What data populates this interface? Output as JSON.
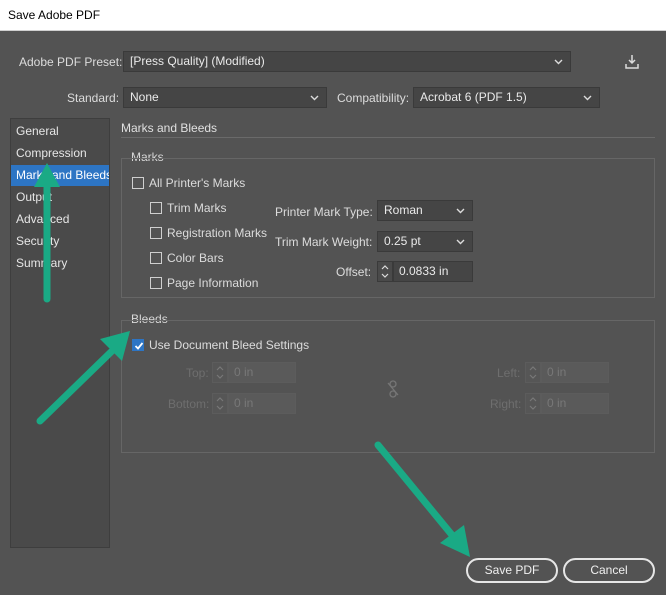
{
  "window": {
    "title": "Save Adobe PDF"
  },
  "preset": {
    "label": "Adobe PDF Preset:",
    "value": "[Press Quality] (Modified)"
  },
  "standard": {
    "label": "Standard:",
    "value": "None"
  },
  "compatibility": {
    "label": "Compatibility:",
    "value": "Acrobat 6 (PDF 1.5)"
  },
  "sidebar": {
    "items": [
      {
        "label": "General"
      },
      {
        "label": "Compression"
      },
      {
        "label": "Marks and Bleeds"
      },
      {
        "label": "Output"
      },
      {
        "label": "Advanced"
      },
      {
        "label": "Security"
      },
      {
        "label": "Summary"
      }
    ],
    "selected": "Marks and Bleeds"
  },
  "panel": {
    "title": "Marks and Bleeds",
    "marks": {
      "title": "Marks",
      "all_printers_marks": {
        "label": "All Printer's Marks",
        "checked": false
      },
      "trim_marks": {
        "label": "Trim Marks",
        "checked": false
      },
      "registration_marks": {
        "label": "Registration Marks",
        "checked": false
      },
      "color_bars": {
        "label": "Color Bars",
        "checked": false
      },
      "page_information": {
        "label": "Page Information",
        "checked": false
      },
      "printer_mark_type": {
        "label": "Printer Mark Type:",
        "value": "Roman"
      },
      "trim_mark_weight": {
        "label": "Trim Mark Weight:",
        "value": "0.25 pt"
      },
      "offset": {
        "label": "Offset:",
        "value": "0.0833 in"
      }
    },
    "bleeds": {
      "title": "Bleeds",
      "use_document_bleed": {
        "label": "Use Document Bleed Settings",
        "checked": true
      },
      "top": {
        "label": "Top:",
        "value": "0 in"
      },
      "bottom": {
        "label": "Bottom:",
        "value": "0 in"
      },
      "left": {
        "label": "Left:",
        "value": "0 in"
      },
      "right": {
        "label": "Right:",
        "value": "0 in"
      }
    }
  },
  "buttons": {
    "save": "Save PDF",
    "cancel": "Cancel"
  },
  "colors": {
    "accent": "#2d75c4",
    "annotation_arrow": "#1aaa85",
    "dialog_bg": "#535353"
  }
}
